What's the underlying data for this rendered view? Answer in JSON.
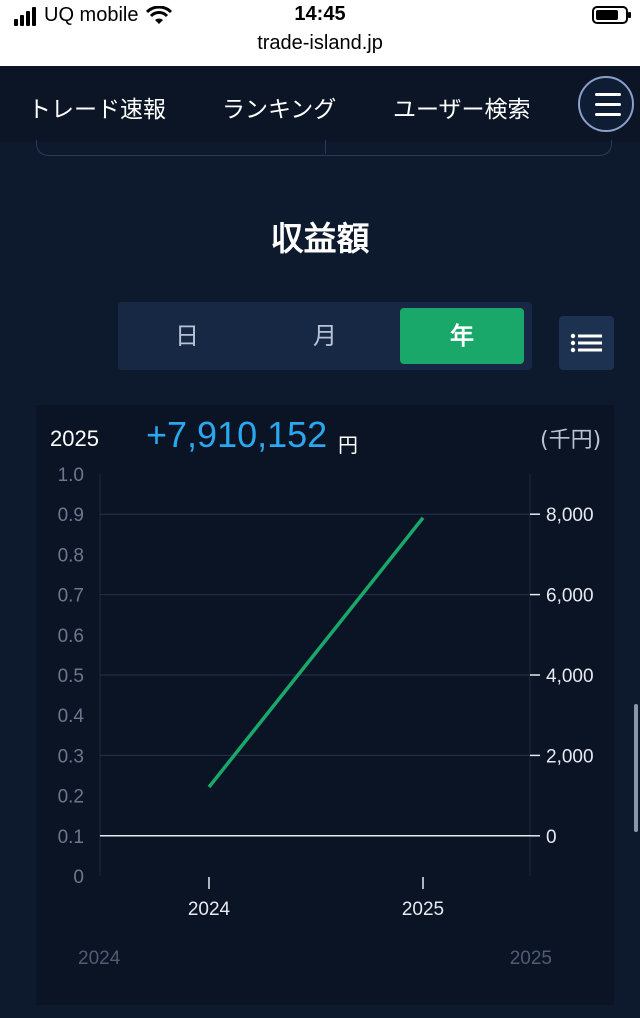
{
  "status_bar": {
    "carrier": "UQ mobile",
    "time": "14:45",
    "url": "trade-island.jp"
  },
  "nav": {
    "items": [
      "トレード速報",
      "ランキング",
      "ユーザー検索"
    ]
  },
  "section": {
    "title": "収益額"
  },
  "period_tabs": {
    "options": [
      "日",
      "月",
      "年"
    ],
    "selected": "年"
  },
  "summary": {
    "year": "2025",
    "profit": "+7,910,152",
    "currency": "円",
    "unit": "(千円)"
  },
  "chart_data": {
    "type": "line",
    "x": [
      "2024",
      "2025"
    ],
    "series": [
      {
        "values": [
          1213,
          7910
        ],
        "color": "#1aa86a"
      }
    ],
    "right_axis": {
      "ticks": [
        0,
        2000,
        4000,
        6000,
        8000
      ],
      "tick_labels": [
        "0",
        "2,000",
        "4,000",
        "6,000",
        "8,000"
      ]
    },
    "left_axis": {
      "ticks": [
        0,
        0.1,
        0.2,
        0.3,
        0.4,
        0.5,
        0.6,
        0.7,
        0.8,
        0.9,
        1.0
      ],
      "tick_labels": [
        "0",
        "0.1",
        "0.2",
        "0.3",
        "0.4",
        "0.5",
        "0.6",
        "0.7",
        "0.8",
        "0.9",
        "1.0"
      ]
    },
    "x_tick_labels": [
      "2024",
      "2025"
    ],
    "range_labels": [
      "2024",
      "2025"
    ],
    "grid": true
  },
  "colors": {
    "accent_green": "#1aa86a",
    "profit_blue": "#29a8f0",
    "background": "#0d1a2e"
  },
  "icons": {
    "menu": "hamburger-icon",
    "list": "list-icon"
  }
}
